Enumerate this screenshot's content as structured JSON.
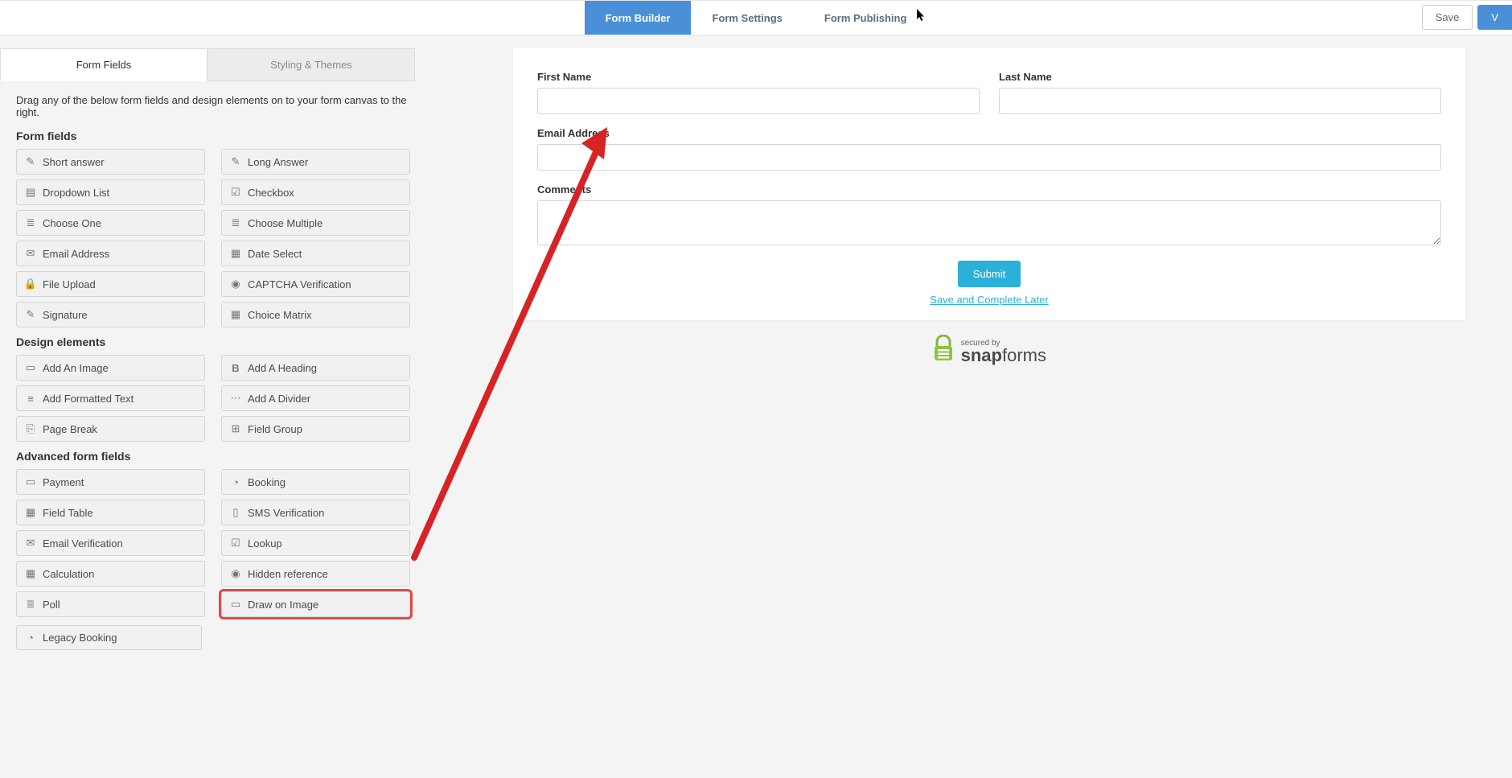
{
  "topTabs": {
    "builder": "Form Builder",
    "settings": "Form Settings",
    "publishing": "Form Publishing"
  },
  "actions": {
    "save": "Save",
    "view": "V"
  },
  "sidebar": {
    "tabs": {
      "fields": "Form Fields",
      "styling": "Styling & Themes"
    },
    "description": "Drag any of the below form fields and design elements on to your form canvas to the right.",
    "sections": {
      "form_fields": "Form fields",
      "design_elements": "Design elements",
      "advanced": "Advanced form fields"
    },
    "form_fields": {
      "short_answer": "Short answer",
      "long_answer": "Long Answer",
      "dropdown_list": "Dropdown List",
      "checkbox": "Checkbox",
      "choose_one": "Choose One",
      "choose_multiple": "Choose Multiple",
      "email_address": "Email Address",
      "date_select": "Date Select",
      "file_upload": "File Upload",
      "captcha": "CAPTCHA Verification",
      "signature": "Signature",
      "choice_matrix": "Choice Matrix"
    },
    "design_elements": {
      "add_image": "Add An Image",
      "add_heading": "Add A Heading",
      "formatted_text": "Add Formatted Text",
      "add_divider": "Add A Divider",
      "page_break": "Page Break",
      "field_group": "Field Group"
    },
    "advanced": {
      "payment": "Payment",
      "booking": "Booking",
      "field_table": "Field Table",
      "sms_verification": "SMS Verification",
      "email_verification": "Email Verification",
      "lookup": "Lookup",
      "calculation": "Calculation",
      "hidden_reference": "Hidden reference",
      "poll": "Poll",
      "draw_on_image": "Draw on Image",
      "legacy_booking": "Legacy Booking"
    }
  },
  "canvas": {
    "first_name": "First Name",
    "last_name": "Last Name",
    "email": "Email Address",
    "comments": "Comments",
    "submit": "Submit",
    "save_later": "Save and Complete Later"
  },
  "secured": {
    "by": "secured by",
    "brand_a": "snap",
    "brand_b": "forms"
  }
}
